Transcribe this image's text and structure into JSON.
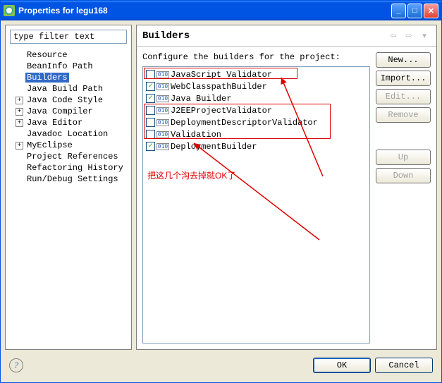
{
  "window": {
    "title": "Properties for legu168"
  },
  "filter": {
    "placeholder": "type filter text"
  },
  "tree": [
    {
      "label": "Resource",
      "expand": null
    },
    {
      "label": "BeanInfo Path",
      "expand": null
    },
    {
      "label": "Builders",
      "expand": null,
      "selected": true
    },
    {
      "label": "Java Build Path",
      "expand": null
    },
    {
      "label": "Java Code Style",
      "expand": "+"
    },
    {
      "label": "Java Compiler",
      "expand": "+"
    },
    {
      "label": "Java Editor",
      "expand": "+"
    },
    {
      "label": "Javadoc Location",
      "expand": null
    },
    {
      "label": "MyEclipse",
      "expand": "+"
    },
    {
      "label": "Project References",
      "expand": null
    },
    {
      "label": "Refactoring History",
      "expand": null
    },
    {
      "label": "Run/Debug Settings",
      "expand": null
    }
  ],
  "page": {
    "title": "Builders",
    "subtitle": "Configure the builders for the project:"
  },
  "builders": [
    {
      "label": "JavaScript Validator",
      "checked": false
    },
    {
      "label": "WebClasspathBuilder",
      "checked": true
    },
    {
      "label": "Java Builder",
      "checked": true
    },
    {
      "label": "J2EEProjectValidator",
      "checked": false
    },
    {
      "label": "DeploymentDescriptorValidator",
      "checked": false
    },
    {
      "label": "Validation",
      "checked": false
    },
    {
      "label": "DeploymentBuilder",
      "checked": true
    }
  ],
  "buttons": {
    "new": "New...",
    "import": "Import...",
    "edit": "Edit...",
    "remove": "Remove",
    "up": "Up",
    "down": "Down"
  },
  "footer": {
    "ok": "OK",
    "cancel": "Cancel",
    "help": "?"
  },
  "annotation": {
    "text": "把这几个沟去掉就OK了"
  }
}
